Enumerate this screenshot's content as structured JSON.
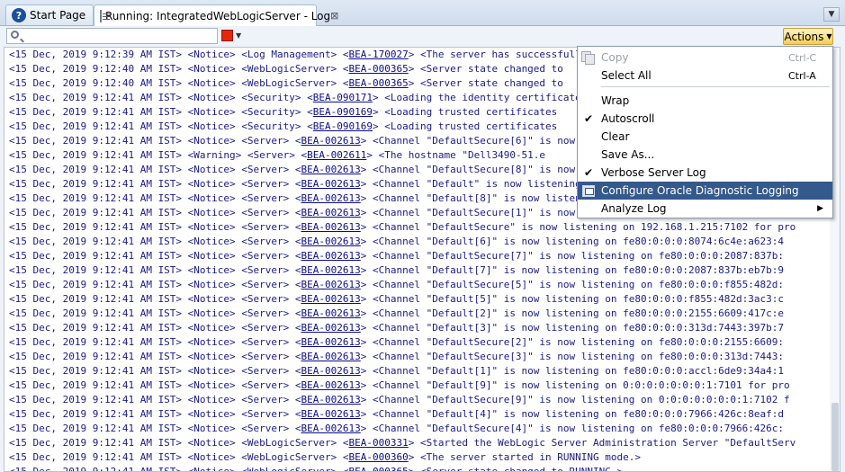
{
  "tabs": [
    {
      "label": "Start Page",
      "icon": "help-icon"
    },
    {
      "label": "Running: IntegratedWebLogicServer - Log",
      "icon": "log-icon",
      "close": "⊠"
    }
  ],
  "toolbar": {
    "search_value": "",
    "actions_label": "Actions",
    "stop_color": "#e8260b"
  },
  "log_lines": [
    {
      "pre": "<15 Dec, 2019 9:12:39 AM IST> <Notice> <Log Management> <",
      "code": "BEA-170027",
      "post": "> <The server has successfully"
    },
    {
      "pre": "<15 Dec, 2019 9:12:40 AM IST> <Notice> <WebLogicServer> <",
      "code": "BEA-000365",
      "post": "> <Server state changed to"
    },
    {
      "pre": "<15 Dec, 2019 9:12:40 AM IST> <Notice> <WebLogicServer> <",
      "code": "BEA-000365",
      "post": "> <Server state changed to"
    },
    {
      "pre": "<15 Dec, 2019 9:12:41 AM IST> <Notice> <Security> <",
      "code": "BEA-090171",
      "post": "> <Loading the identity certificate"
    },
    {
      "pre": "<15 Dec, 2019 9:12:41 AM IST> <Notice> <Security> <",
      "code": "BEA-090169",
      "post": "> <Loading trusted certificates"
    },
    {
      "pre": "<15 Dec, 2019 9:12:41 AM IST> <Notice> <Security> <",
      "code": "BEA-090169",
      "post": "> <Loading trusted certificates"
    },
    {
      "pre": "<15 Dec, 2019 9:12:41 AM IST> <Notice> <Server> <",
      "code": "BEA-002613",
      "post": "> <Channel \"DefaultSecure[6]\" is now"
    },
    {
      "pre": "<15 Dec, 2019 9:12:41 AM IST> <Warning> <Server> <",
      "code": "BEA-002611",
      "post": "> <The hostname \"Dell3490-51.e"
    },
    {
      "pre": "<15 Dec, 2019 9:12:41 AM IST> <Notice> <Server> <",
      "code": "BEA-002613",
      "post": "> <Channel \"DefaultSecure[8]\" is now"
    },
    {
      "pre": "<15 Dec, 2019 9:12:41 AM IST> <Notice> <Server> <",
      "code": "BEA-002613",
      "post": "> <Channel \"Default\" is now listening"
    },
    {
      "pre": "<15 Dec, 2019 9:12:41 AM IST> <Notice> <Server> <",
      "code": "BEA-002613",
      "post": "> <Channel \"Default[8]\" is now listening"
    },
    {
      "pre": "<15 Dec, 2019 9:12:41 AM IST> <Notice> <Server> <",
      "code": "BEA-002613",
      "post": "> <Channel \"DefaultSecure[1]\" is now"
    },
    {
      "pre": "<15 Dec, 2019 9:12:41 AM IST> <Notice> <Server> <",
      "code": "BEA-002613",
      "post": "> <Channel \"DefaultSecure\" is now listening on 192.168.1.215:7102 for pro"
    },
    {
      "pre": "<15 Dec, 2019 9:12:41 AM IST> <Notice> <Server> <",
      "code": "BEA-002613",
      "post": "> <Channel \"Default[6]\" is now listening on fe80:0:0:0:8074:6c4e:a623:4"
    },
    {
      "pre": "<15 Dec, 2019 9:12:41 AM IST> <Notice> <Server> <",
      "code": "BEA-002613",
      "post": "> <Channel \"DefaultSecure[7]\" is now listening on fe80:0:0:0:2087:837b:"
    },
    {
      "pre": "<15 Dec, 2019 9:12:41 AM IST> <Notice> <Server> <",
      "code": "BEA-002613",
      "post": "> <Channel \"Default[7]\" is now listening on fe80:0:0:0:2087:837b:eb7b:9"
    },
    {
      "pre": "<15 Dec, 2019 9:12:41 AM IST> <Notice> <Server> <",
      "code": "BEA-002613",
      "post": "> <Channel \"DefaultSecure[5]\" is now listening on fe80:0:0:0:f855:482d:"
    },
    {
      "pre": "<15 Dec, 2019 9:12:41 AM IST> <Notice> <Server> <",
      "code": "BEA-002613",
      "post": "> <Channel \"Default[5]\" is now listening on fe80:0:0:0:f855:482d:3ac3:c"
    },
    {
      "pre": "<15 Dec, 2019 9:12:41 AM IST> <Notice> <Server> <",
      "code": "BEA-002613",
      "post": "> <Channel \"Default[2]\" is now listening on fe80:0:0:0:2155:6609:417c:e"
    },
    {
      "pre": "<15 Dec, 2019 9:12:41 AM IST> <Notice> <Server> <",
      "code": "BEA-002613",
      "post": "> <Channel \"Default[3]\" is now listening on fe80:0:0:0:313d:7443:397b:7"
    },
    {
      "pre": "<15 Dec, 2019 9:12:41 AM IST> <Notice> <Server> <",
      "code": "BEA-002613",
      "post": "> <Channel \"DefaultSecure[2]\" is now listening on fe80:0:0:0:2155:6609:"
    },
    {
      "pre": "<15 Dec, 2019 9:12:41 AM IST> <Notice> <Server> <",
      "code": "BEA-002613",
      "post": "> <Channel \"DefaultSecure[3]\" is now listening on fe80:0:0:0:313d:7443:"
    },
    {
      "pre": "<15 Dec, 2019 9:12:41 AM IST> <Notice> <Server> <",
      "code": "BEA-002613",
      "post": "> <Channel \"Default[1]\" is now listening on fe80:0:0:0:accl:6de9:34a4:1"
    },
    {
      "pre": "<15 Dec, 2019 9:12:41 AM IST> <Notice> <Server> <",
      "code": "BEA-002613",
      "post": "> <Channel \"Default[9]\" is now listening on 0:0:0:0:0:0:0:1:7101 for pro"
    },
    {
      "pre": "<15 Dec, 2019 9:12:41 AM IST> <Notice> <Server> <",
      "code": "BEA-002613",
      "post": "> <Channel \"DefaultSecure[9]\" is now listening on 0:0:0:0:0:0:0:1:7102 f"
    },
    {
      "pre": "<15 Dec, 2019 9:12:41 AM IST> <Notice> <Server> <",
      "code": "BEA-002613",
      "post": "> <Channel \"Default[4]\" is now listening on fe80:0:0:0:7966:426c:8eaf:d"
    },
    {
      "pre": "<15 Dec, 2019 9:12:41 AM IST> <Notice> <Server> <",
      "code": "BEA-002613",
      "post": "> <Channel \"DefaultSecure[4]\" is now listening on fe80:0:0:0:7966:426c:"
    },
    {
      "pre": "<15 Dec, 2019 9:12:41 AM IST> <Notice> <WebLogicServer> <",
      "code": "BEA-000331",
      "post": "> <Started the WebLogic Server Administration Server \"DefaultServ"
    },
    {
      "pre": "<15 Dec, 2019 9:12:41 AM IST> <Notice> <WebLogicServer> <",
      "code": "BEA-000360",
      "post": "> <The server started in RUNNING mode.>"
    },
    {
      "pre": "<15 Dec, 2019 9:12:41 AM IST> <Notice> <WebLogicServer> <",
      "code": "BEA-000365",
      "post": "> <Server state changed to RUNNING.>"
    }
  ],
  "context_menu": {
    "copy": {
      "label": "Copy",
      "shortcut": "Ctrl-C"
    },
    "select_all": {
      "label": "Select All",
      "shortcut": "Ctrl-A"
    },
    "wrap": "Wrap",
    "autoscroll": "Autoscroll",
    "clear": "Clear",
    "save_as": "Save As...",
    "verbose": "Verbose Server Log",
    "configure": "Configure Oracle Diagnostic Logging",
    "analyze": "Analyze Log",
    "check_glyph": "✔",
    "submenu_glyph": "▶"
  }
}
